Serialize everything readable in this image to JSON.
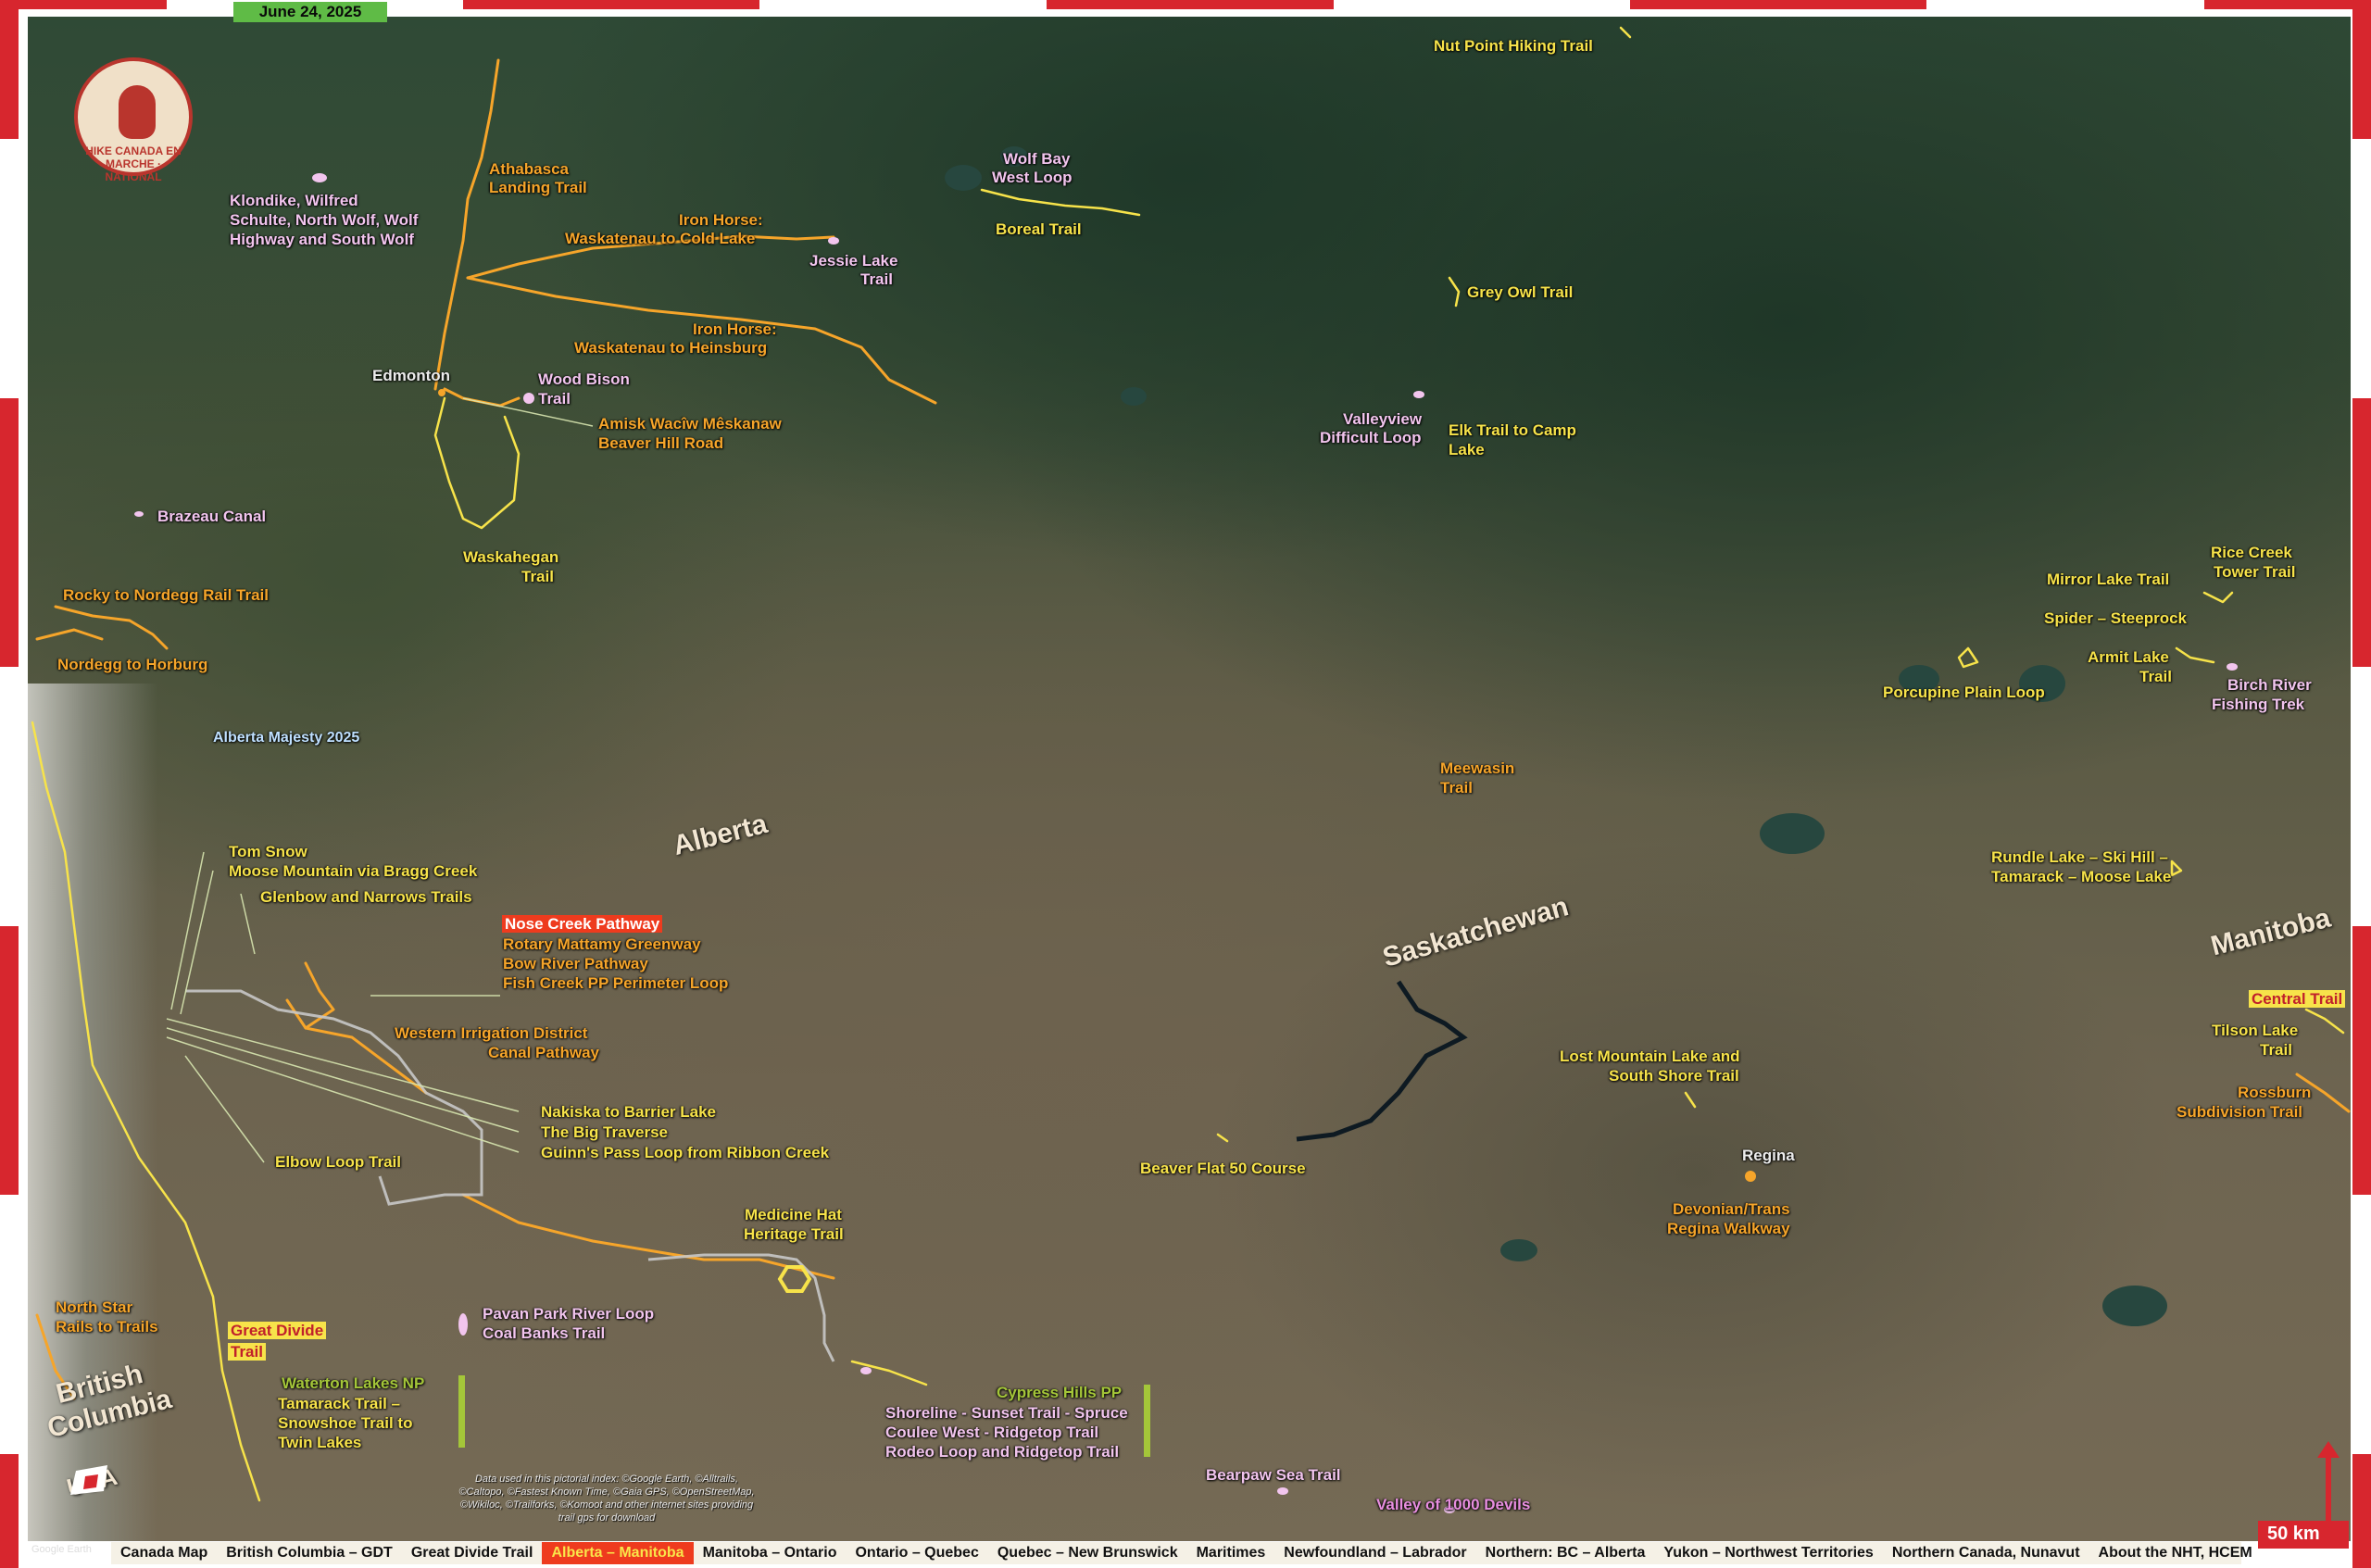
{
  "header": {
    "date": "June 24, 2025"
  },
  "logo": {
    "text": "HIKE CANADA EN MARCHE · NATIONAL"
  },
  "regions": {
    "alberta": "Alberta",
    "saskatchewan": "Saskatchewan",
    "manitoba": "Manitoba",
    "british_columbia_1": "British",
    "british_columbia_2": "Columbia",
    "usa": "USA"
  },
  "cities": {
    "edmonton": "Edmonton",
    "regina": "Regina"
  },
  "trails": {
    "nut_point": "Nut Point Hiking Trail",
    "wolf_bay_1": "Wolf Bay",
    "wolf_bay_2": "West Loop",
    "boreal": "Boreal Trail",
    "athabasca_1": "Athabasca",
    "athabasca_2": "Landing Trail",
    "klondike_1": "Klondike, Wilfred",
    "klondike_2": "Schulte, North Wolf, Wolf",
    "klondike_3": "Highway and South Wolf",
    "iron_horse_cold_1": "Iron Horse:",
    "iron_horse_cold_2": "Waskatenau to Cold Lake",
    "jessie_1": "Jessie Lake",
    "jessie_2": "Trail",
    "iron_horse_heins_1": "Iron Horse:",
    "iron_horse_heins_2": "Waskatenau to Heinsburg",
    "grey_owl": "Grey Owl Trail",
    "wood_bison_1": "Wood Bison",
    "wood_bison_2": "Trail",
    "amisk_1": "Amisk Wacîw Mêskanaw",
    "amisk_2": "Beaver Hill Road",
    "valleyview_1": "Valleyview",
    "valleyview_2": "Difficult Loop",
    "elk_1": "Elk Trail to Camp",
    "elk_2": "Lake",
    "brazeau": "Brazeau Canal",
    "waskahegan_1": "Waskahegan",
    "waskahegan_2": "Trail",
    "rocky_nordegg": "Rocky to Nordegg Rail Trail",
    "nordegg_horburg": "Nordegg to Horburg",
    "rice_creek_1": "Rice Creek",
    "rice_creek_2": "Tower Trail",
    "mirror_lake": "Mirror Lake Trail",
    "spider": "Spider – Steeprock",
    "armit_1": "Armit Lake",
    "armit_2": "Trail",
    "porcupine": "Porcupine Plain Loop",
    "birch_1": "Birch River",
    "birch_2": "Fishing Trek",
    "alberta_majesty": "Alberta Majesty 2025",
    "meewasin_1": "Meewasin",
    "meewasin_2": "Trail",
    "tom_snow": "Tom Snow",
    "moose_mountain": "Moose Mountain via Bragg Creek",
    "glenbow": "Glenbow and Narrows Trails",
    "nose_creek": "Nose Creek Pathway",
    "rotary": "Rotary Mattamy Greenway",
    "bow_river": "Bow River Pathway",
    "fish_creek": "Fish Creek PP Perimeter Loop",
    "rundle_1": "Rundle Lake – Ski Hill –",
    "rundle_2": "Tamarack – Moose Lake",
    "western_irrigation_1": "Western Irrigation District",
    "western_irrigation_2": "Canal Pathway",
    "central_trail": "Central Trail",
    "tilson_1": "Tilson Lake",
    "tilson_2": "Trail",
    "lost_mountain_1": "Lost Mountain Lake and",
    "lost_mountain_2": "South Shore Trail",
    "nakiska": "Nakiska to Barrier Lake",
    "big_traverse": "The Big Traverse",
    "guinns_pass": "Guinn's Pass Loop from Ribbon Creek",
    "rossburn_1": "Rossburn",
    "rossburn_2": "Subdivision Trail",
    "elbow_loop": "Elbow Loop Trail",
    "beaver_flat": "Beaver Flat 50 Course",
    "medicine_hat_1": "Medicine Hat",
    "medicine_hat_2": "Heritage Trail",
    "devonian_1": "Devonian/Trans",
    "devonian_2": "Regina Walkway",
    "north_star_1": "North Star",
    "north_star_2": "Rails to Trails",
    "pavan_1": "Pavan Park River Loop",
    "pavan_2": "Coal Banks Trail",
    "great_divide_1": "Great Divide",
    "great_divide_2": "Trail",
    "waterton_np": "Waterton Lakes NP",
    "tamarack_1": "Tamarack Trail –",
    "tamarack_2": "Snowshoe Trail to",
    "tamarack_3": "Twin Lakes",
    "cypress_pp": "Cypress Hills PP",
    "shoreline_1": "Shoreline - Sunset Trail - Spruce",
    "shoreline_2": "Coulee West - Ridgetop Trail",
    "shoreline_3": "Rodeo Loop and Ridgetop Trail",
    "bearpaw": "Bearpaw Sea Trail",
    "valley_1000": "Valley of 1000 Devils"
  },
  "credits": "Data used in this pictorial index: ©Google Earth, ©Alltrails, ©Caltopo, ©Fastest Known Time, ©Gaia GPS, ©OpenStreetMap, ©Wikiloc, ©Trailforks, ©Komoot and other internet sites providing trail gps for download",
  "google_credit": "Google Earth",
  "scale": "50 km",
  "bottom_nav": {
    "items": [
      "Canada Map",
      "British Columbia – GDT",
      "Great Divide Trail",
      "Alberta – Manitoba",
      "Manitoba – Ontario",
      "Ontario – Quebec",
      "Quebec – New Brunswick",
      "Maritimes",
      "Newfoundland – Labrador",
      "Northern: BC – Alberta",
      "Yukon – Northwest Territories",
      "Northern Canada, Nunavut",
      "About the NHT, HCEM"
    ],
    "active": "Alberta – Manitoba"
  },
  "colors": {
    "frame_red": "#d7262e",
    "trail_yellow": "#f7e34a",
    "trail_orange": "#f6a52a",
    "trail_pink": "#f2c5ee",
    "date_badge": "#5fbb46",
    "active_nav": "#ee3b1e"
  },
  "icons": {
    "north_arrow": "north-arrow-icon",
    "hiker_logo": "hiker-boot-icon",
    "usa_badge": "usa-badge-icon"
  }
}
